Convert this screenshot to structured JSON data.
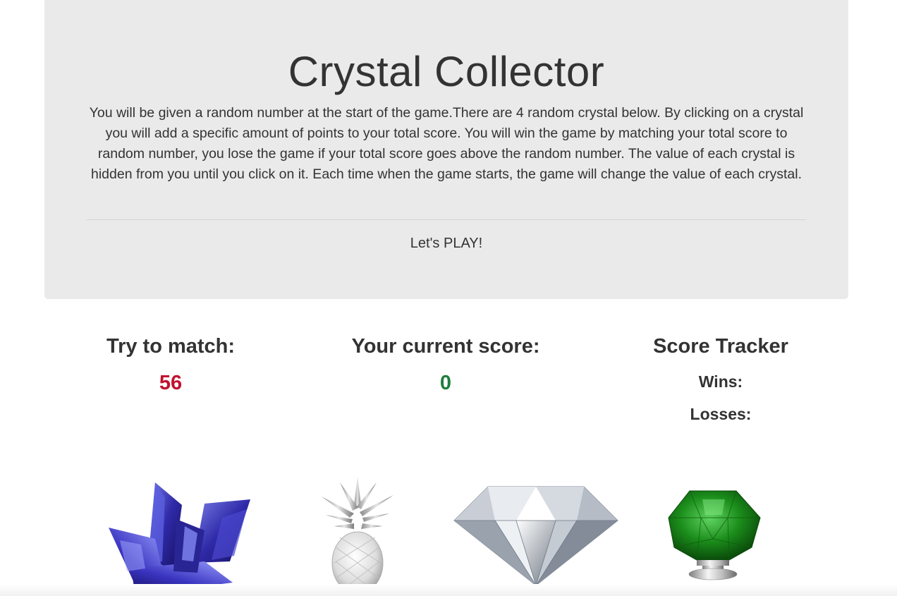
{
  "header": {
    "title": "Crystal Collector",
    "intro": "You will be given a random number at the start of the game.There are 4 random crystal below. By clicking on a crystal you will add a specific amount of points to your total score. You will win the game by matching your total score to random number, you lose the game if your total score goes above the random number. The value of each crystal is hidden from you until you click on it. Each time when the game starts, the game will change the value of each crystal.",
    "play": "Let's PLAY!"
  },
  "target": {
    "label": "Try to match:",
    "value": "56",
    "color": "#c1122f"
  },
  "current": {
    "label": "Your current score:",
    "value": "0",
    "color": "#1e7e3e"
  },
  "tracker": {
    "label": "Score Tracker",
    "wins_label": "Wins:",
    "losses_label": "Losses:"
  },
  "crystals": [
    {
      "icon": "blue-crystal-cluster-icon",
      "color": "#3b3fb8"
    },
    {
      "icon": "crystal-pineapple-icon",
      "color": "#c8c8c8"
    },
    {
      "icon": "diamond-icon",
      "color": "#b9bfc7"
    },
    {
      "icon": "green-crystal-knob-icon",
      "color": "#1e8a1e"
    }
  ]
}
